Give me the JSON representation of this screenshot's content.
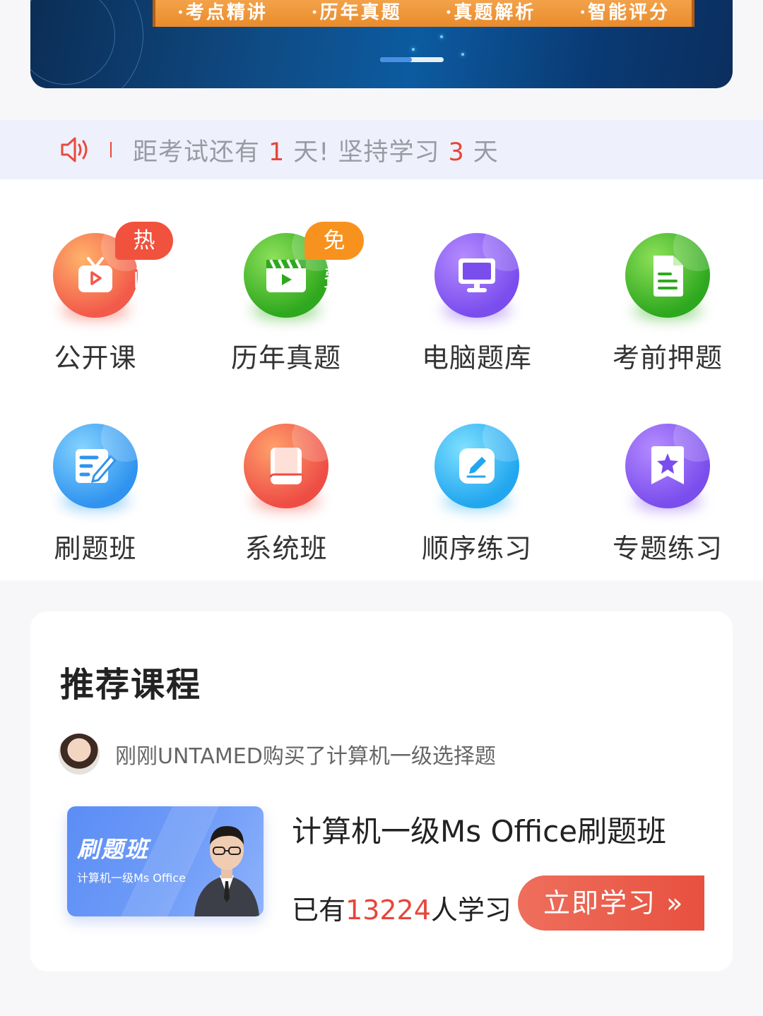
{
  "banner": {
    "features": [
      "·考点精讲",
      "·历年真题",
      "·真题解析",
      "·智能评分"
    ]
  },
  "notice": {
    "prefix": "距考试还有",
    "days_to_exam": "1",
    "middle": "天!  坚持学习",
    "study_days": "3",
    "suffix": "天"
  },
  "menu": [
    {
      "label": "公开课",
      "icon": "tv-play-icon",
      "tag": "热门",
      "color": "#f25a4a"
    },
    {
      "label": "历年真题",
      "icon": "clapper-play-icon",
      "tag": "免费",
      "color": "#3fb62a"
    },
    {
      "label": "电脑题库",
      "icon": "monitor-icon",
      "tag": "",
      "color": "#8a5df0"
    },
    {
      "label": "考前押题",
      "icon": "document-icon",
      "tag": "",
      "color": "#3fb62a"
    },
    {
      "label": "刷题班",
      "icon": "edit-list-icon",
      "tag": "",
      "color": "#3aa6f5"
    },
    {
      "label": "系统班",
      "icon": "book-icon",
      "tag": "",
      "color": "#f25a4a"
    },
    {
      "label": "顺序练习",
      "icon": "pencil-icon",
      "tag": "",
      "color": "#2eb4f0"
    },
    {
      "label": "专题练习",
      "icon": "star-bookmark-icon",
      "tag": "",
      "color": "#8a5df0"
    }
  ],
  "recommend": {
    "title": "推荐课程",
    "buyer_text": "刚刚UNTAMED购买了计算机一级选择题",
    "course": {
      "thumb_title": "刷题班",
      "thumb_subtitle": "计算机一级Ms Office",
      "name": "计算机一级Ms Office刷题班",
      "learners_prefix": "已有",
      "learners_count": "13224",
      "learners_suffix": "人学习",
      "button": "立即学习 »"
    }
  }
}
